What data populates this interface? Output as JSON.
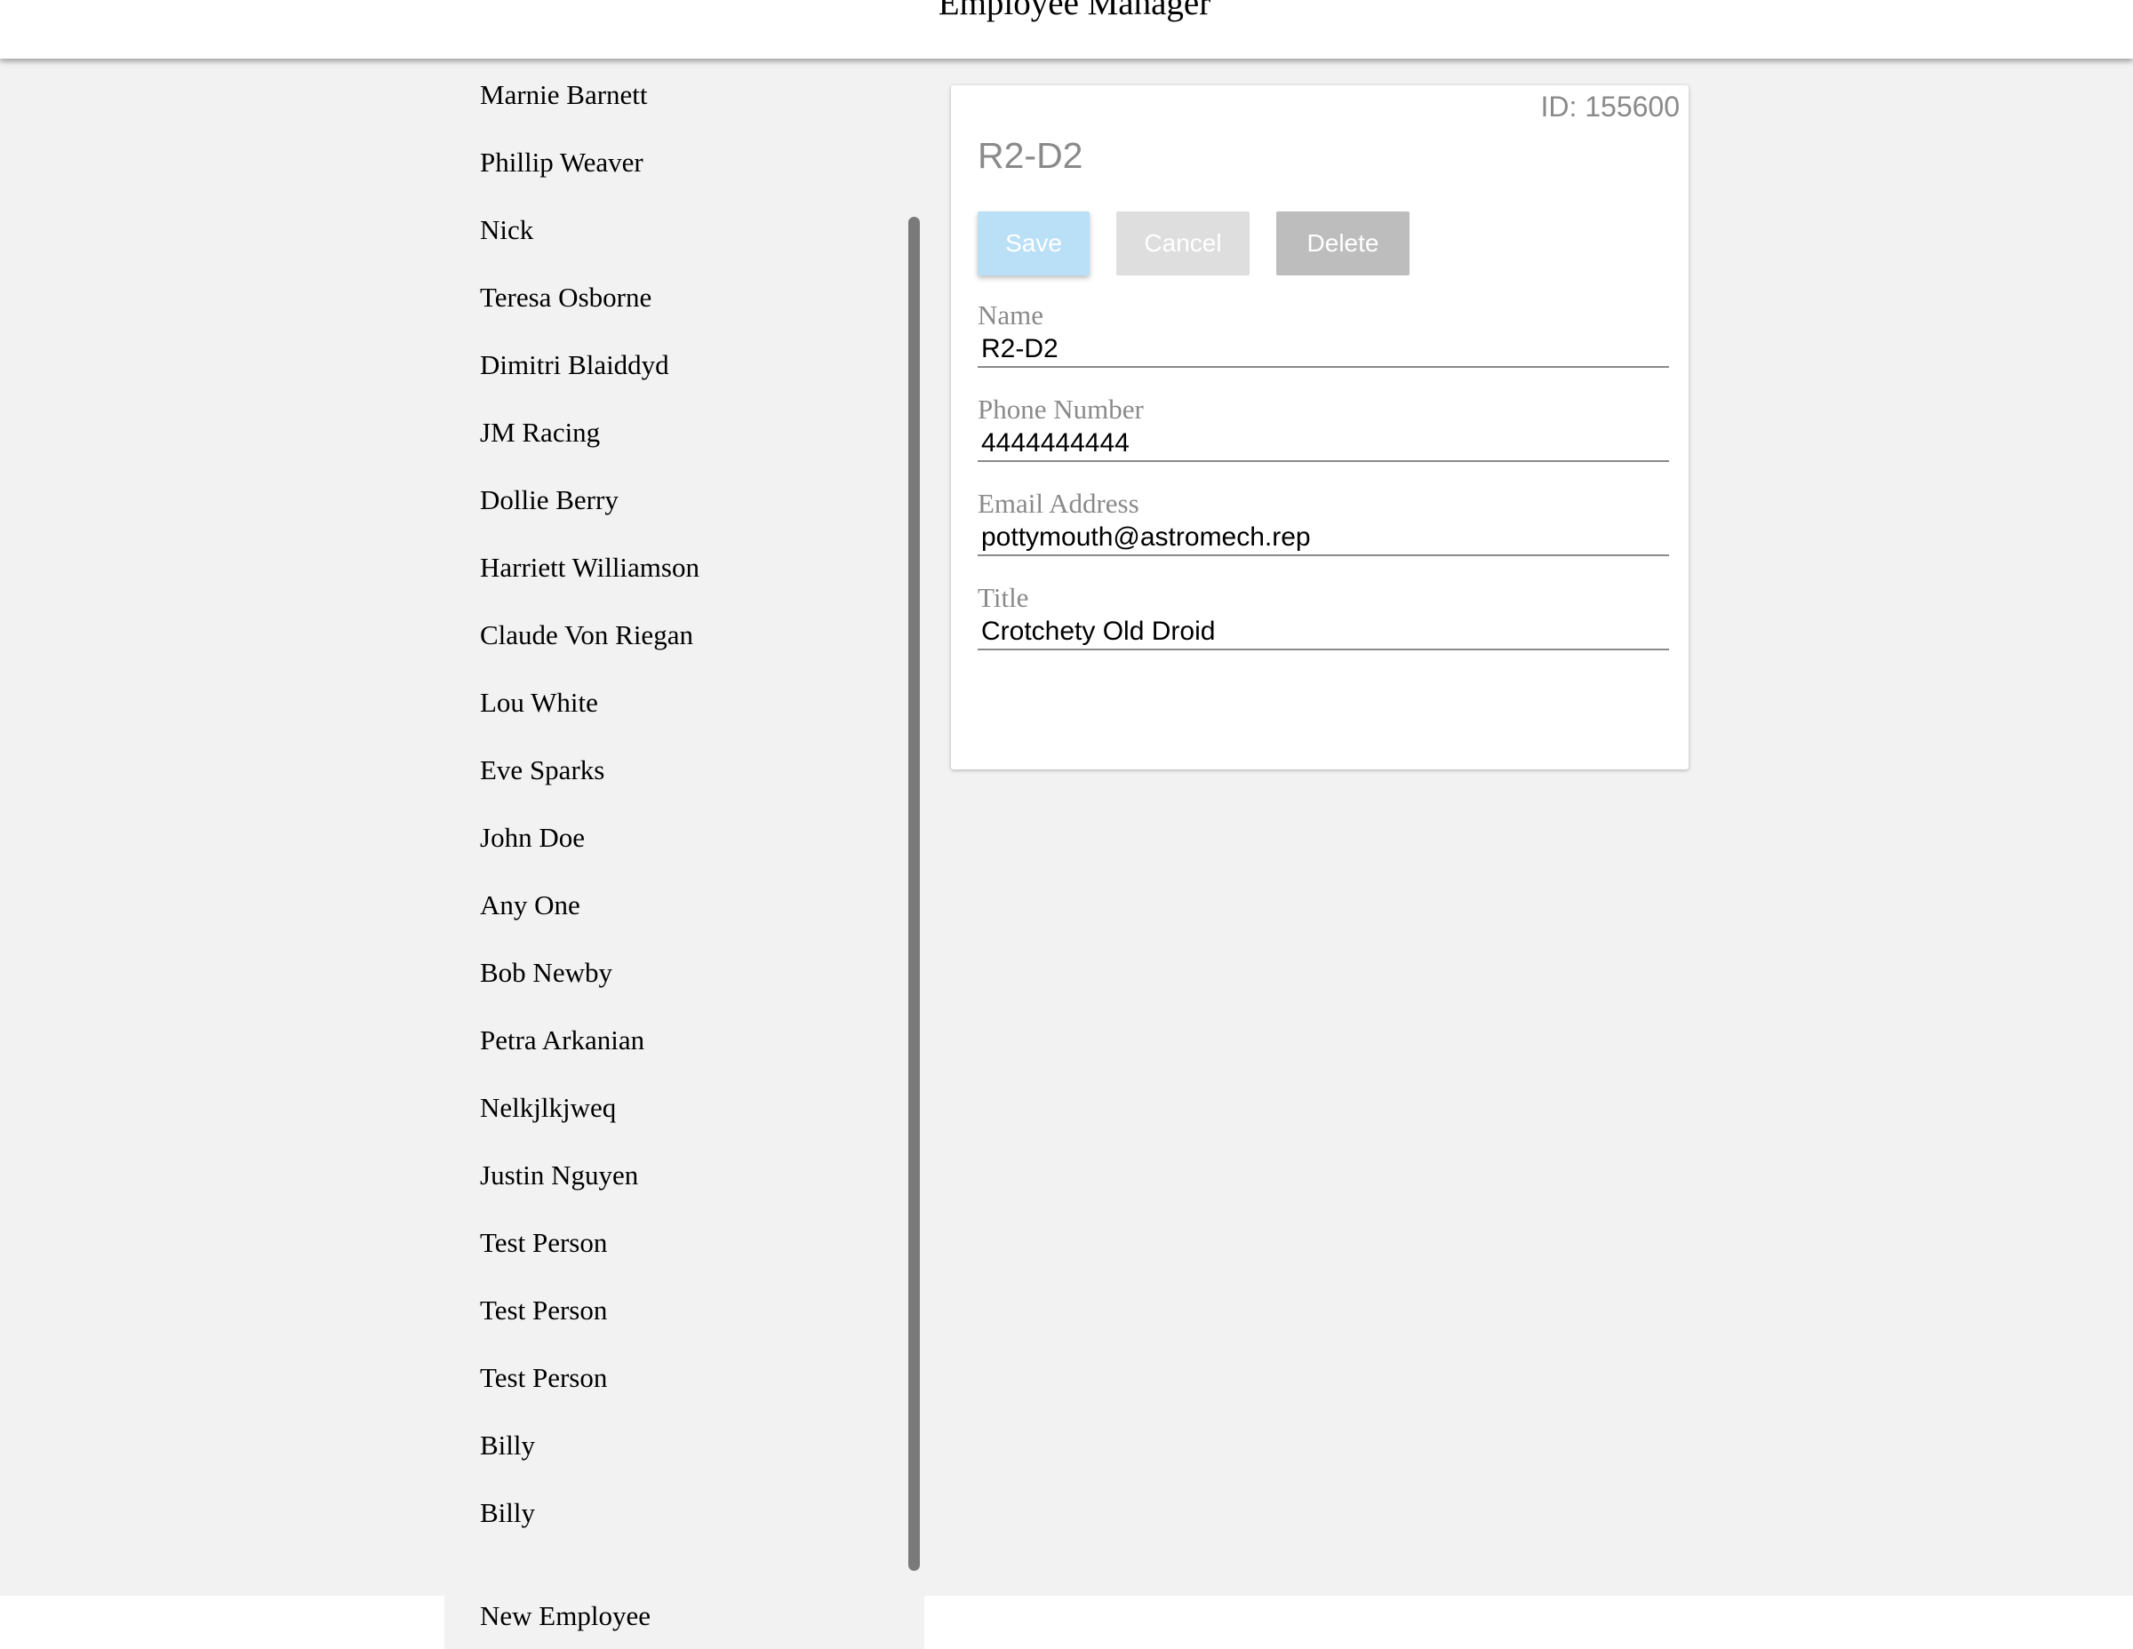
{
  "header": {
    "title": "Employee Manager"
  },
  "employees": [
    "Marnie Barnett",
    "Phillip Weaver",
    "Nick",
    "Teresa Osborne",
    "Dimitri Blaiddyd",
    "JM Racing",
    "Dollie Berry",
    "Harriett Williamson",
    "Claude Von Riegan",
    "Lou White",
    "Eve Sparks",
    "John Doe",
    "Any One",
    "Bob Newby",
    "Petra Arkanian",
    "Nelkjlkjweq",
    "Justin Nguyen",
    "Test Person",
    "Test Person",
    "Test Person",
    "Billy",
    "Billy"
  ],
  "new_employee_label": "New Employee",
  "detail": {
    "id_label": "ID: 155600",
    "title": "R2-D2",
    "buttons": {
      "save": "Save",
      "cancel": "Cancel",
      "delete": "Delete"
    },
    "fields": {
      "name": {
        "label": "Name",
        "value": "R2-D2"
      },
      "phone": {
        "label": "Phone Number",
        "value": "4444444444"
      },
      "email": {
        "label": "Email Address",
        "value": "pottymouth@astromech.rep"
      },
      "title": {
        "label": "Title",
        "value": "Crotchety Old Droid"
      }
    }
  },
  "colors": {
    "background": "#f2f2f2",
    "save_button": "#b9e0f7",
    "cancel_button": "#dedede",
    "delete_button": "#bdbdbd",
    "muted_text": "#8a8a8a"
  }
}
